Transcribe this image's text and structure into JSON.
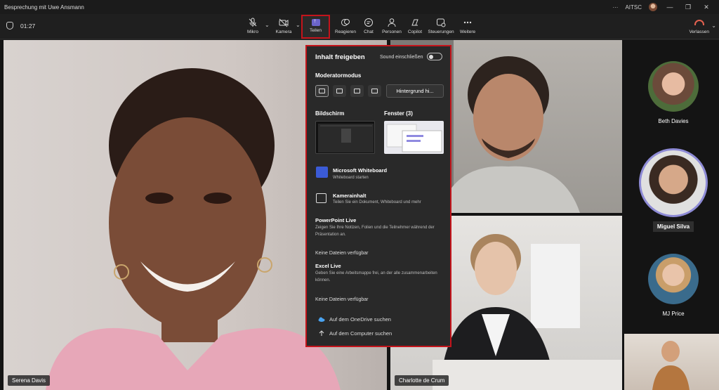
{
  "window": {
    "title": "Besprechung mit Uwe Ansmann",
    "dots": "···",
    "org": "AITSC",
    "min": "—",
    "max": "❐",
    "close": "✕"
  },
  "toolbar": {
    "timer": "01:27",
    "mic": "Mikro",
    "camera": "Kamera",
    "share": "Teilen",
    "react": "Reagieren",
    "chat": "Chat",
    "people": "Personen",
    "copilot": "Copilot",
    "controls": "Steuerungen",
    "more": "Weitere",
    "leave": "Verlassen"
  },
  "participants": {
    "main_left": "Serena Davis",
    "bottom_center": "Charlotte de Crum",
    "side": [
      "Beth Davies",
      "Miguel Silva",
      "MJ Price"
    ]
  },
  "share_panel": {
    "title": "Inhalt freigeben",
    "sound_label": "Sound einschließen",
    "presenter_mode": "Moderatormodus",
    "background_button": "Hintergrund hi...",
    "screen": "Bildschirm",
    "window": "Fenster (3)",
    "whiteboard_title": "Microsoft Whiteboard",
    "whiteboard_sub": "Whiteboard starten",
    "camera_title": "Kamerainhalt",
    "camera_sub": "Teilen Sie ein Dokument, Whiteboard und mehr",
    "ppt_title": "PowerPoint Live",
    "ppt_sub": "Zeigen Sie Ihre Notizen, Folien und die Teilnehmer während der Präsentation an.",
    "no_files_1": "Keine Dateien verfügbar",
    "excel_title": "Excel Live",
    "excel_sub": "Geben Sie eine Arbeitsmappe frei, an der alle zusammenarbeiten können.",
    "no_files_2": "Keine Dateien verfügbar",
    "onedrive": "Auf dem OneDrive suchen",
    "computer": "Auf dem Computer suchen"
  },
  "colors": {
    "accent": "#6b64c9",
    "highlight": "#c4141b",
    "leave": "#e2614f"
  }
}
